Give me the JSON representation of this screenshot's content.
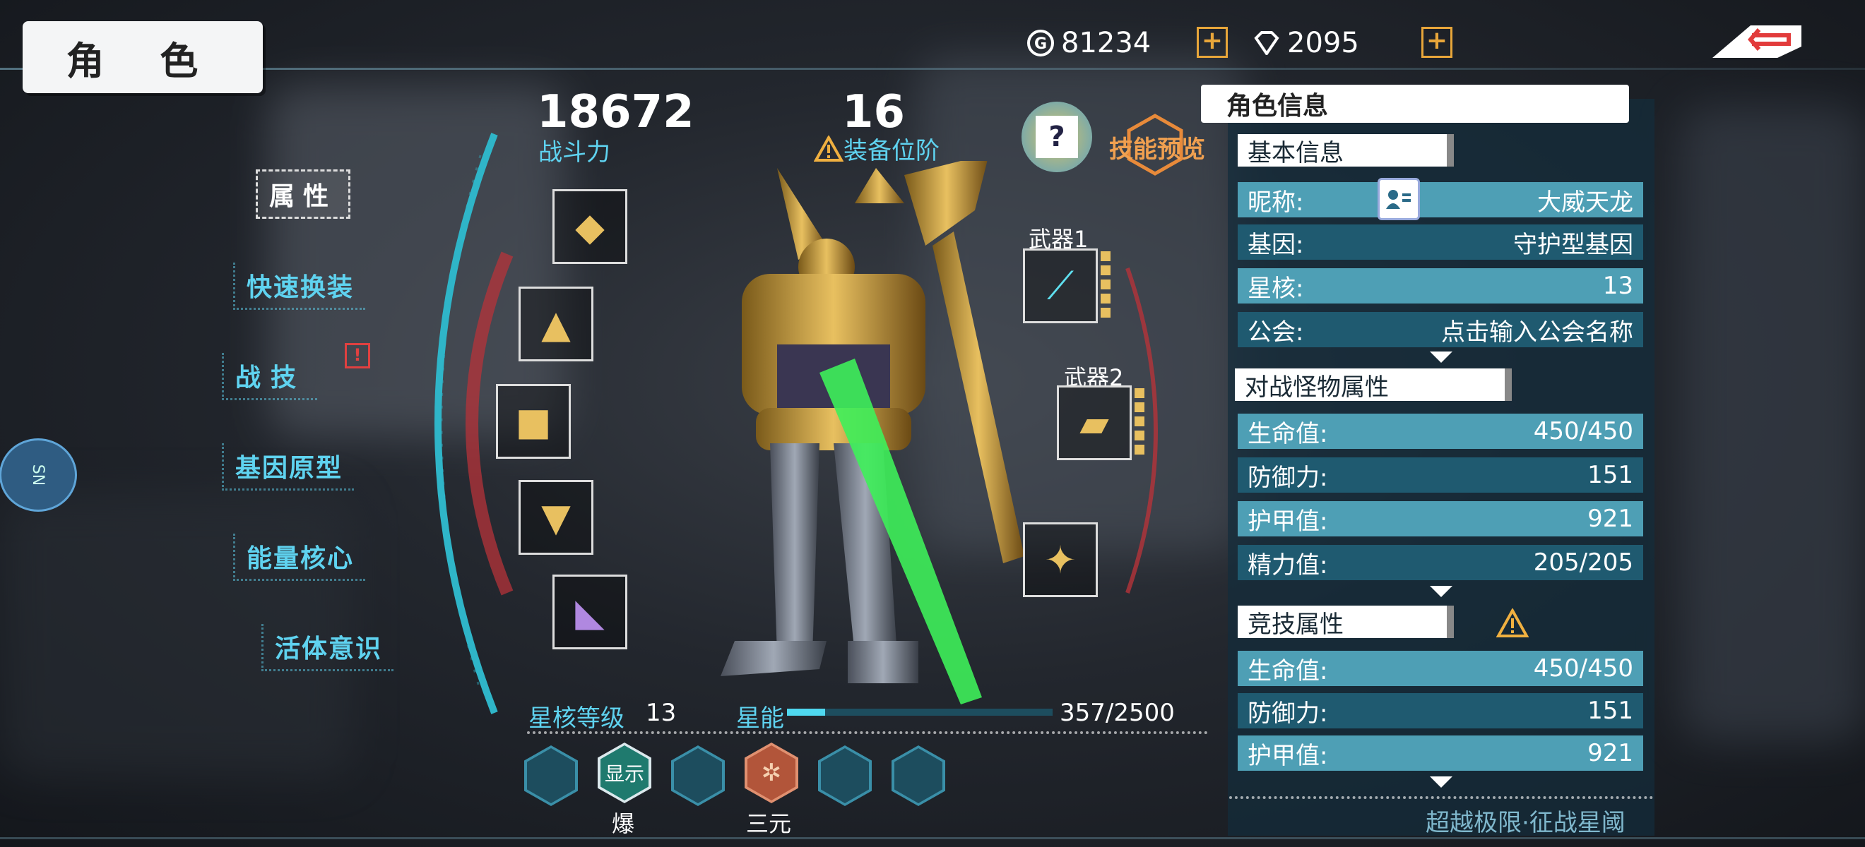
{
  "header": {
    "title": "角 色",
    "currency": [
      {
        "icon": "gold-coin-icon",
        "value": "81234"
      },
      {
        "icon": "diamond-icon",
        "value": "2095"
      }
    ]
  },
  "menu": {
    "items": [
      {
        "label": "属性",
        "active": true
      },
      {
        "label": "快速换装"
      },
      {
        "label": "战技",
        "alert": "!"
      },
      {
        "label": "基因原型"
      },
      {
        "label": "能量核心"
      },
      {
        "label": "活体意识"
      }
    ]
  },
  "stats": {
    "power_value": "18672",
    "power_label": "战斗力",
    "equip_value": "16",
    "equip_label": "装备位阶",
    "skill_preview_label": "技能预览",
    "help_label": "?"
  },
  "weapons": {
    "weapon1_label": "武器1",
    "weapon2_label": "武器2"
  },
  "star_core": {
    "level_label": "星核等级",
    "level_value": "13",
    "energy_label": "星能",
    "energy_value": "357/2500",
    "energy_fraction": 0.143
  },
  "hex_slots": {
    "show_label": "显示",
    "labels": [
      "爆",
      "三元"
    ]
  },
  "panel": {
    "title": "角色信息",
    "basic": {
      "title": "基本信息",
      "rows": [
        {
          "label": "昵称:",
          "value": "大威天龙"
        },
        {
          "label": "基因:",
          "value": "守护型基因"
        },
        {
          "label": "星核:",
          "value": "13"
        },
        {
          "label": "公会:",
          "value": "点击输入公会名称"
        }
      ]
    },
    "pve": {
      "title": "对战怪物属性",
      "rows": [
        {
          "label": "生命值:",
          "value": "450/450"
        },
        {
          "label": "防御力:",
          "value": "151"
        },
        {
          "label": "护甲值:",
          "value": "921"
        },
        {
          "label": "精力值:",
          "value": "205/205"
        }
      ]
    },
    "pvp": {
      "title": "竞技属性",
      "rows": [
        {
          "label": "生命值:",
          "value": "450/450"
        },
        {
          "label": "防御力:",
          "value": "151"
        },
        {
          "label": "护甲值:",
          "value": "921"
        }
      ]
    },
    "footer": "超越极限·征战星阈"
  },
  "side_button": {
    "label": "SN"
  }
}
